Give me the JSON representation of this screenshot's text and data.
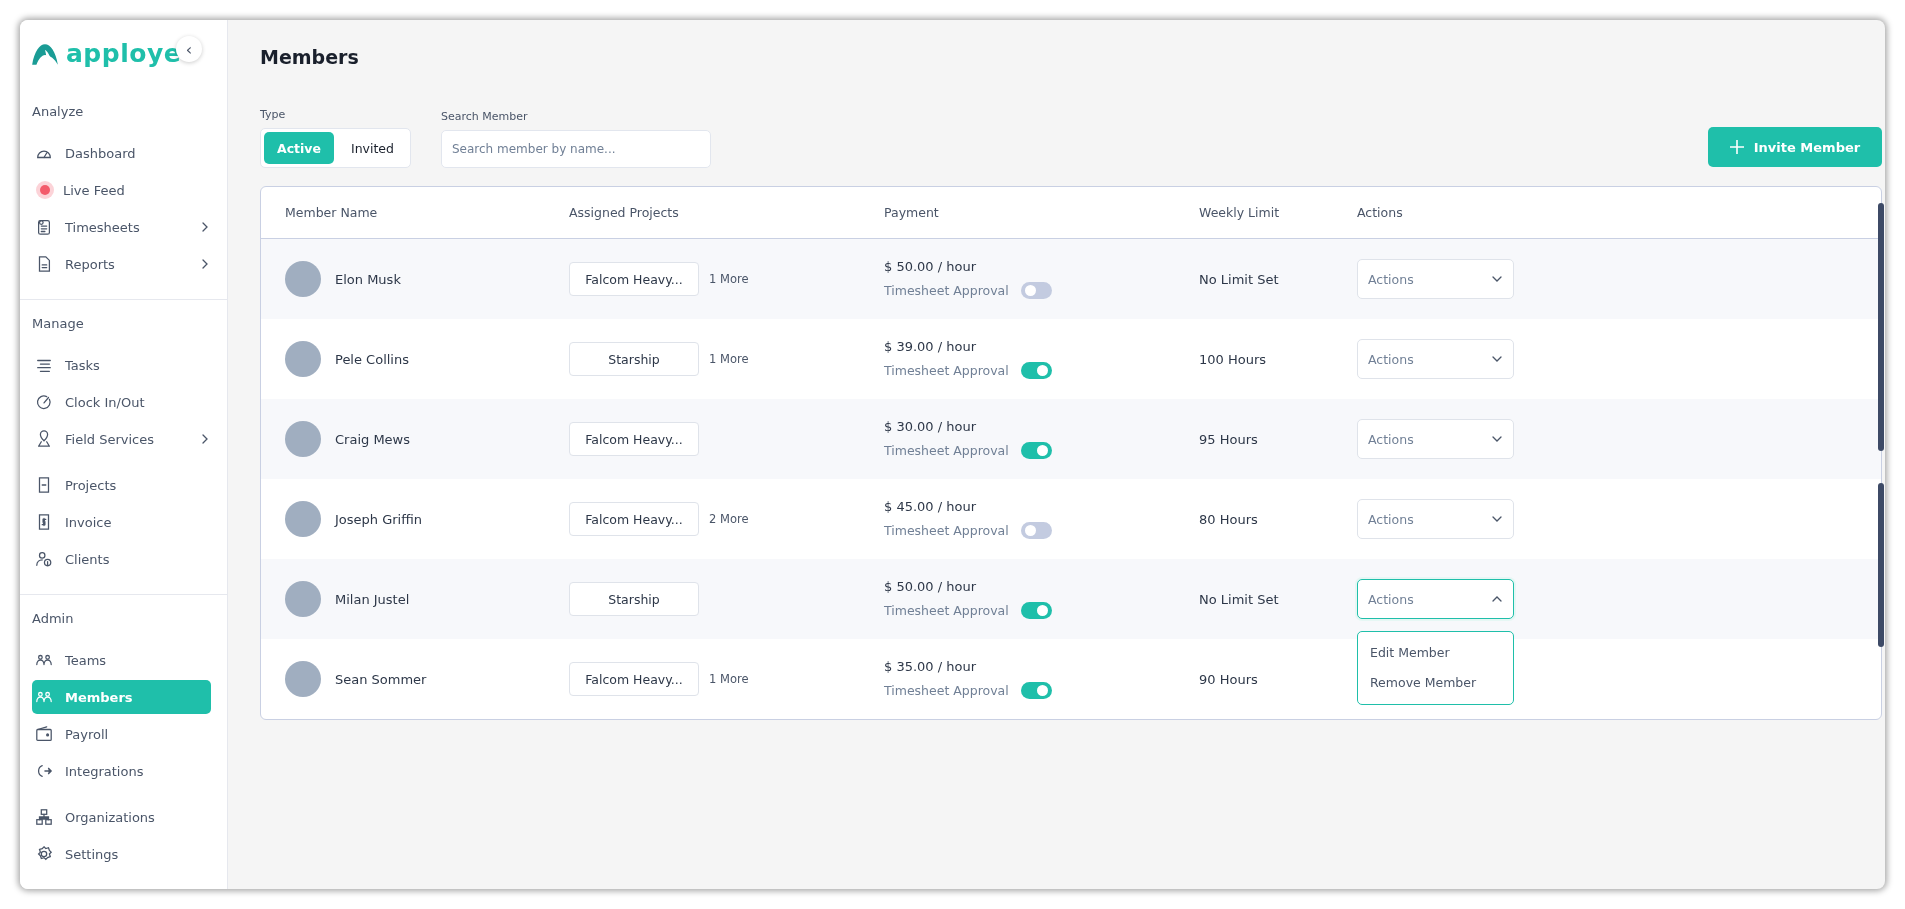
{
  "sidebar": {
    "logo": "apploye",
    "collapse_icon": "‹",
    "sections": [
      {
        "title": "Analyze",
        "groups": [
          [
            {
              "label": "Dashboard",
              "kind": "gauge",
              "expandable": false,
              "selected": false
            },
            {
              "label": "Live Feed",
              "kind": "dot",
              "expandable": false,
              "selected": false
            },
            {
              "label": "Timesheets",
              "kind": "clipboard",
              "expandable": true,
              "selected": false
            },
            {
              "label": "Reports",
              "kind": "document",
              "expandable": true,
              "selected": false
            }
          ]
        ]
      },
      {
        "title": "Manage",
        "groups": [
          [
            {
              "label": "Tasks",
              "kind": "lines",
              "expandable": false,
              "selected": false
            },
            {
              "label": "Clock In/Out",
              "kind": "clock",
              "expandable": false,
              "selected": false
            },
            {
              "label": "Field Services",
              "kind": "pin",
              "expandable": true,
              "selected": false
            }
          ],
          [
            {
              "label": "Projects",
              "kind": "file",
              "expandable": false,
              "selected": false
            },
            {
              "label": "Invoice",
              "kind": "receipt",
              "expandable": false,
              "selected": false
            },
            {
              "label": "Clients",
              "kind": "user",
              "expandable": false,
              "selected": false
            }
          ]
        ]
      },
      {
        "title": "Admin",
        "groups": [
          [
            {
              "label": "Teams",
              "kind": "team",
              "expandable": false,
              "selected": false
            },
            {
              "label": "Members",
              "kind": "team",
              "expandable": false,
              "selected": true
            },
            {
              "label": "Payroll",
              "kind": "wallet",
              "expandable": false,
              "selected": false
            },
            {
              "label": "Integrations",
              "kind": "plug",
              "expandable": false,
              "selected": false
            }
          ],
          [
            {
              "label": "Organizations",
              "kind": "tree",
              "expandable": false,
              "selected": false
            },
            {
              "label": "Settings",
              "kind": "gear",
              "expandable": false,
              "selected": false
            }
          ]
        ]
      }
    ]
  },
  "page": {
    "title": "Members",
    "type_filter": {
      "label": "Type",
      "options": [
        {
          "label": "Active",
          "selected": true
        },
        {
          "label": "Invited",
          "selected": false
        }
      ]
    },
    "search": {
      "label": "Search Member",
      "placeholder": "Search member by name..."
    },
    "invite_button": "Invite Member"
  },
  "table": {
    "columns": [
      "Member Name",
      "Assigned Projects",
      "Payment",
      "Weekly Limit",
      "Actions"
    ],
    "rows": [
      {
        "name": "Elon Musk",
        "project": "Falcom Heavy...",
        "more": "1 More",
        "rate": "$ 50.00 / hour",
        "approval_label": "Timesheet Approval",
        "approval_on": false,
        "weekly_limit": "No Limit Set",
        "actions": {
          "label": "Actions",
          "expanded": false
        }
      },
      {
        "name": "Pele Collins",
        "project": "Starship",
        "more": "1 More",
        "rate": "$ 39.00 / hour",
        "approval_label": "Timesheet Approval",
        "approval_on": true,
        "weekly_limit": "100 Hours",
        "actions": {
          "label": "Actions",
          "expanded": false
        }
      },
      {
        "name": "Craig Mews",
        "project": "Falcom Heavy...",
        "rate": "$ 30.00 / hour",
        "approval_label": "Timesheet Approval",
        "approval_on": true,
        "weekly_limit": "95 Hours",
        "actions": {
          "label": "Actions",
          "expanded": false
        }
      },
      {
        "name": "Joseph Griffin",
        "project": "Falcom Heavy...",
        "more": "2 More",
        "rate": "$ 45.00 / hour",
        "approval_label": "Timesheet Approval",
        "approval_on": false,
        "weekly_limit": "80 Hours",
        "actions": {
          "label": "Actions",
          "expanded": false
        }
      },
      {
        "name": "Milan Justel",
        "project": "Starship",
        "rate": "$ 50.00 / hour",
        "approval_label": "Timesheet Approval",
        "approval_on": true,
        "weekly_limit": "No Limit Set",
        "actions": {
          "label": "Actions",
          "expanded": true,
          "menu": [
            "Edit Member",
            "Remove Member"
          ]
        }
      },
      {
        "name": "Sean Sommer",
        "project": "Falcom Heavy...",
        "more": "1 More",
        "rate": "$ 35.00 / hour",
        "approval_label": "Timesheet Approval",
        "approval_on": true,
        "weekly_limit": "90 Hours"
      }
    ]
  }
}
